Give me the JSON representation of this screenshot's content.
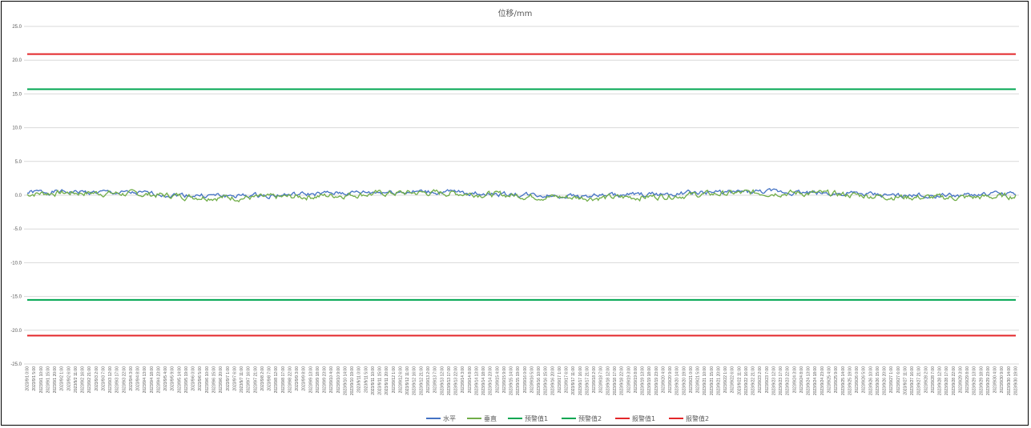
{
  "chart_data": {
    "type": "line",
    "title": "位移/mm",
    "ylim": [
      -25,
      25
    ],
    "yticks": [
      "25.0",
      "20.0",
      "15.0",
      "10.0",
      "5.0",
      "0.0",
      "-5.0",
      "-10.0",
      "-15.0",
      "-20.0",
      "-25.0"
    ],
    "grid": true,
    "legend_position": "bottom",
    "x_start": "2023/9/1 0:00",
    "x_end": "2023/9/30 19:00",
    "x_label_step_hours": 5,
    "series": [
      {
        "name": "水平",
        "color": "#4472c4",
        "kind": "wave",
        "mean": 0.2,
        "amp": 0.35,
        "seed": 1
      },
      {
        "name": "垂直",
        "color": "#70ad47",
        "kind": "wave",
        "mean": 0.0,
        "amp": 0.45,
        "seed": 7
      },
      {
        "name": "预警值1",
        "color": "#00a651",
        "kind": "const",
        "value": 15.7
      },
      {
        "name": "预警值2",
        "color": "#00a651",
        "kind": "const",
        "value": -15.5
      },
      {
        "name": "报警值1",
        "color": "#e3262a",
        "kind": "const",
        "value": 20.9
      },
      {
        "name": "报警值2",
        "color": "#e3262a",
        "kind": "const",
        "value": -20.8
      }
    ]
  }
}
